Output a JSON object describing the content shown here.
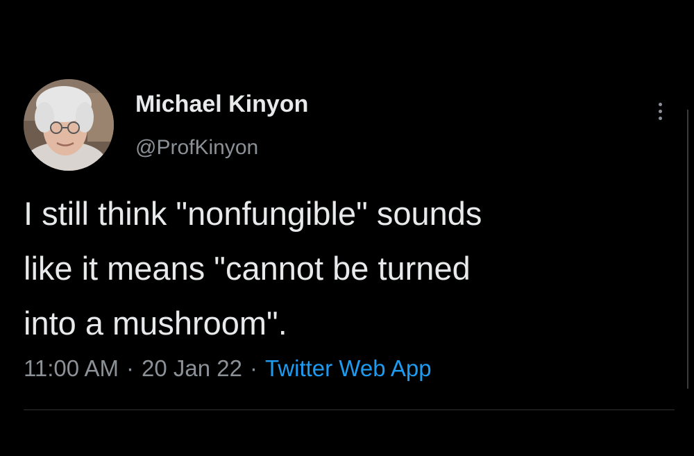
{
  "tweet": {
    "author": {
      "display_name": "Michael Kinyon",
      "handle": "@ProfKinyon"
    },
    "text": "I still think \"nonfungible\" sounds\nlike it means \"cannot be turned\ninto a mushroom\".",
    "time": "11:00 AM",
    "separator": "·",
    "date": "20 Jan 22",
    "source": "Twitter Web App"
  },
  "icons": {
    "more": "more-options-icon"
  },
  "colors": {
    "background": "#000000",
    "text": "#e7e9ea",
    "secondary_text": "#8b9196",
    "link": "#1d9bf0",
    "divider": "#2f3336"
  }
}
